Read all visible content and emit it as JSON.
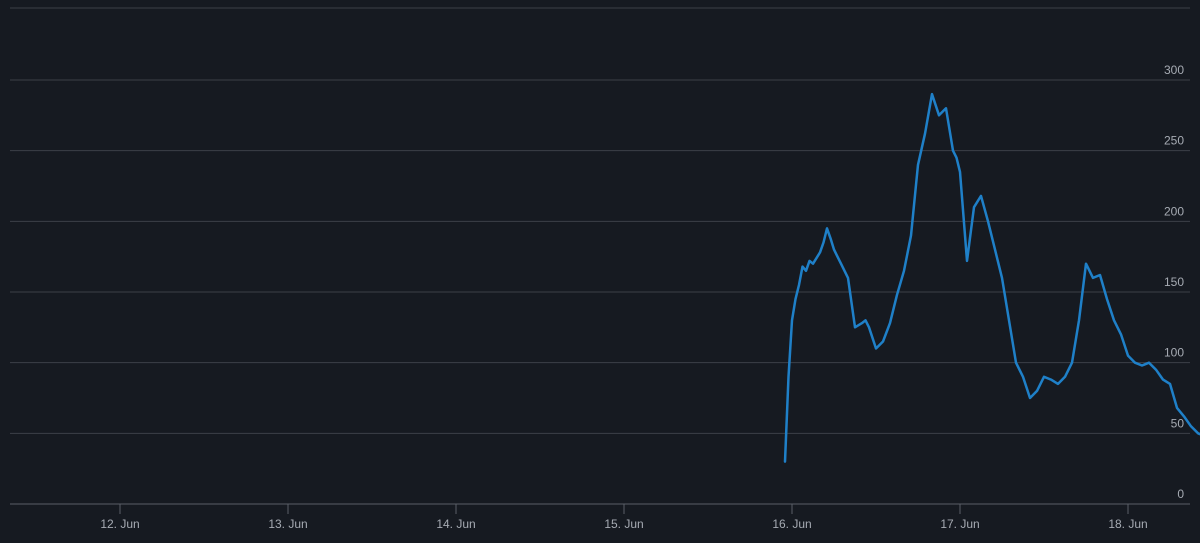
{
  "chart_data": {
    "type": "line",
    "title": "",
    "xlabel": "",
    "ylabel": "",
    "ylim": [
      0,
      300
    ],
    "yticks": [
      0,
      50,
      100,
      150,
      200,
      250,
      300
    ],
    "xticks": [
      "12. Jun",
      "13. Jun",
      "14. Jun",
      "15. Jun",
      "16. Jun",
      "17. Jun",
      "18. Jun"
    ],
    "grid": true,
    "legend": "none",
    "colors": {
      "background": "#161a21",
      "grid": "#3c4048",
      "series": "#1f80c8",
      "text": "#a6abb3"
    },
    "series": [
      {
        "x": [
          "2017-06-15 23:00",
          "2017-06-15 23:30",
          "2017-06-16 00:00",
          "2017-06-16 00:30",
          "2017-06-16 01:00",
          "2017-06-16 01:30",
          "2017-06-16 02:00",
          "2017-06-16 02:30",
          "2017-06-16 03:00",
          "2017-06-16 04:00",
          "2017-06-16 04:30",
          "2017-06-16 05:00",
          "2017-06-16 05:30",
          "2017-06-16 06:00",
          "2017-06-16 06:30",
          "2017-06-16 07:00",
          "2017-06-16 08:00",
          "2017-06-16 09:00",
          "2017-06-16 10:00",
          "2017-06-16 10:30",
          "2017-06-16 11:00",
          "2017-06-16 12:00",
          "2017-06-16 13:00",
          "2017-06-16 14:00",
          "2017-06-16 15:00",
          "2017-06-16 16:00",
          "2017-06-16 17:00",
          "2017-06-16 18:00",
          "2017-06-16 19:00",
          "2017-06-16 20:00",
          "2017-06-16 21:00",
          "2017-06-16 22:00",
          "2017-06-16 23:00",
          "2017-06-16 23:30",
          "2017-06-17 00:00",
          "2017-06-17 01:00",
          "2017-06-17 02:00",
          "2017-06-17 03:00",
          "2017-06-17 04:00",
          "2017-06-17 05:00",
          "2017-06-17 06:00",
          "2017-06-17 07:00",
          "2017-06-17 08:00",
          "2017-06-17 09:00",
          "2017-06-17 10:00",
          "2017-06-17 11:00",
          "2017-06-17 12:00",
          "2017-06-17 13:00",
          "2017-06-17 14:00",
          "2017-06-17 15:00",
          "2017-06-17 16:00",
          "2017-06-17 17:00",
          "2017-06-17 17:30",
          "2017-06-17 18:00",
          "2017-06-17 19:00",
          "2017-06-17 20:00",
          "2017-06-17 21:00",
          "2017-06-17 22:00",
          "2017-06-17 23:00",
          "2017-06-18 00:00",
          "2017-06-18 01:00",
          "2017-06-18 02:00",
          "2017-06-18 03:00",
          "2017-06-18 04:00",
          "2017-06-18 05:00",
          "2017-06-18 06:00",
          "2017-06-18 07:00",
          "2017-06-18 08:00",
          "2017-06-18 09:00",
          "2017-06-18 10:00",
          "2017-06-18 11:00"
        ],
        "y": [
          30,
          90,
          130,
          145,
          155,
          168,
          165,
          172,
          170,
          178,
          185,
          195,
          188,
          180,
          175,
          170,
          160,
          125,
          128,
          130,
          125,
          110,
          115,
          128,
          148,
          165,
          190,
          240,
          262,
          290,
          275,
          280,
          250,
          245,
          235,
          172,
          210,
          218,
          200,
          180,
          160,
          130,
          100,
          90,
          75,
          80,
          90,
          88,
          85,
          90,
          100,
          130,
          150,
          170,
          160,
          162,
          145,
          130,
          120,
          105,
          100,
          98,
          100,
          95,
          88,
          85,
          68,
          62,
          55,
          50,
          48
        ]
      }
    ]
  }
}
